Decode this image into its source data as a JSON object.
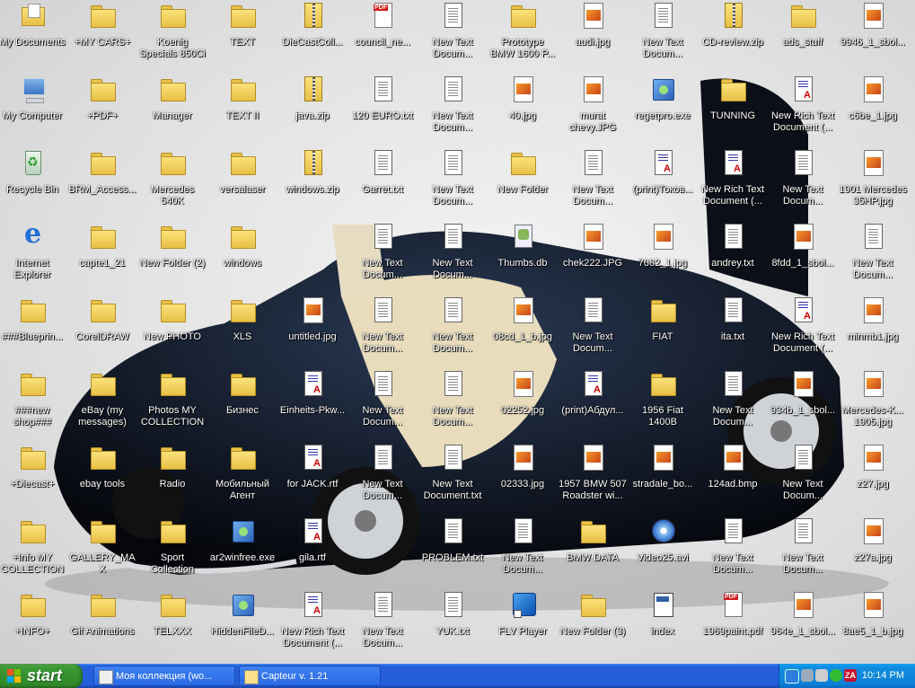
{
  "desktop": {
    "icons": [
      {
        "label": "My Documents",
        "type": "mydocs"
      },
      {
        "label": "My Computer",
        "type": "mycomp"
      },
      {
        "label": "Recycle Bin",
        "type": "recycle"
      },
      {
        "label": "Internet Explorer",
        "type": "ie"
      },
      {
        "label": "###Blueprin...",
        "type": "folder"
      },
      {
        "label": "###new shop###",
        "type": "folder"
      },
      {
        "label": "+Diecast+",
        "type": "folder"
      },
      {
        "label": "+Info MY COLLECTION+",
        "type": "folder"
      },
      {
        "label": "+INFO+",
        "type": "folder"
      },
      {
        "label": "+MY CARS+",
        "type": "folder"
      },
      {
        "label": "+PDF+",
        "type": "folder"
      },
      {
        "label": "BRM_Access...",
        "type": "folder"
      },
      {
        "label": "capte1_21",
        "type": "folder"
      },
      {
        "label": "CorelDRAW",
        "type": "folder"
      },
      {
        "label": "eBay (my messages)",
        "type": "folder"
      },
      {
        "label": "ebay tools",
        "type": "folder"
      },
      {
        "label": "GALLERY_MAX",
        "type": "folder"
      },
      {
        "label": "Gif Animations",
        "type": "folder"
      },
      {
        "label": "Koenig Specials 850Ci",
        "type": "folder"
      },
      {
        "label": "Manager",
        "type": "folder"
      },
      {
        "label": "Mercedes 540K",
        "type": "folder"
      },
      {
        "label": "New Folder (2)",
        "type": "folder"
      },
      {
        "label": "New PHOTO",
        "type": "folder"
      },
      {
        "label": "Photos MY COLLECTION",
        "type": "folder"
      },
      {
        "label": "Radio",
        "type": "folder"
      },
      {
        "label": "Sport Collection",
        "type": "folder"
      },
      {
        "label": "TELXXX",
        "type": "folder"
      },
      {
        "label": "TEXT",
        "type": "folder"
      },
      {
        "label": "TEXT II",
        "type": "folder"
      },
      {
        "label": "versalaser",
        "type": "folder"
      },
      {
        "label": "windows",
        "type": "folder"
      },
      {
        "label": "XLS",
        "type": "folder"
      },
      {
        "label": "Бизнес",
        "type": "folder"
      },
      {
        "label": "Мобильный Агент",
        "type": "folder"
      },
      {
        "label": "ar2winfree.exe",
        "type": "exe"
      },
      {
        "label": "HiddenFileD...",
        "type": "exe"
      },
      {
        "label": "DieCastColl...",
        "type": "zip"
      },
      {
        "label": "java.zip",
        "type": "zip"
      },
      {
        "label": "windows.zip",
        "type": "zip"
      },
      {
        "label": "",
        "type": "none"
      },
      {
        "label": "untitled.jpg",
        "type": "img"
      },
      {
        "label": "Einheits-Pkw...",
        "type": "rtf"
      },
      {
        "label": "for JACK.rtf",
        "type": "rtf"
      },
      {
        "label": "gila.rtf",
        "type": "rtf"
      },
      {
        "label": "New Rich Text Document (...",
        "type": "rtf"
      },
      {
        "label": "council_ne...",
        "type": "pdf"
      },
      {
        "label": "120 EURO.txt",
        "type": "doc"
      },
      {
        "label": "Garret.txt",
        "type": "doc"
      },
      {
        "label": "New Text Docum...",
        "type": "doc"
      },
      {
        "label": "New Text Docum...",
        "type": "doc"
      },
      {
        "label": "New Text Docum...",
        "type": "doc"
      },
      {
        "label": "New Text Docum...",
        "type": "doc"
      },
      {
        "label": "",
        "type": "none"
      },
      {
        "label": "New Text Docum...",
        "type": "doc"
      },
      {
        "label": "New Text Docum...",
        "type": "doc"
      },
      {
        "label": "New Text Docum...",
        "type": "doc"
      },
      {
        "label": "New Text Docum...",
        "type": "doc"
      },
      {
        "label": "New Text Docum...",
        "type": "doc"
      },
      {
        "label": "New Text Docum...",
        "type": "doc"
      },
      {
        "label": "New Text Docum...",
        "type": "doc"
      },
      {
        "label": "New Text Document.txt",
        "type": "doc"
      },
      {
        "label": "PROBLEM.txt",
        "type": "doc"
      },
      {
        "label": "YUK.txt",
        "type": "doc"
      },
      {
        "label": "Prototype BMW 1600 P...",
        "type": "folder"
      },
      {
        "label": "40.jpg",
        "type": "img"
      },
      {
        "label": "New Folder",
        "type": "folder"
      },
      {
        "label": "Thumbs.db",
        "type": "db"
      },
      {
        "label": "08cd_1_b.jpg",
        "type": "img"
      },
      {
        "label": "02252.jpg",
        "type": "img"
      },
      {
        "label": "02333.jpg",
        "type": "img"
      },
      {
        "label": "New Text Docum...",
        "type": "doc"
      },
      {
        "label": "FLV Player",
        "type": "flv"
      },
      {
        "label": "audi.jpg",
        "type": "img"
      },
      {
        "label": "murat chevy.JPG",
        "type": "img"
      },
      {
        "label": "New Text Docum...",
        "type": "doc"
      },
      {
        "label": "chek222.JPG",
        "type": "img"
      },
      {
        "label": "New Text Docum...",
        "type": "doc"
      },
      {
        "label": "(print)Абдул...",
        "type": "rtf"
      },
      {
        "label": "1957 BMW 507 Roadster wi...",
        "type": "img"
      },
      {
        "label": "BMW DATA",
        "type": "folder"
      },
      {
        "label": "New Folder (3)",
        "type": "folder"
      },
      {
        "label": "New Text Docum...",
        "type": "doc"
      },
      {
        "label": "regetpro.exe",
        "type": "exe"
      },
      {
        "label": "(print)Токов...",
        "type": "rtf"
      },
      {
        "label": "7082_1.jpg",
        "type": "img"
      },
      {
        "label": "FIAT",
        "type": "folder"
      },
      {
        "label": "1956 Fiat 1400B",
        "type": "folder"
      },
      {
        "label": "stradale_bo...",
        "type": "img"
      },
      {
        "label": "Video25.avi",
        "type": "avi"
      },
      {
        "label": "index",
        "type": "html"
      },
      {
        "label": "CD-review.zip",
        "type": "zip"
      },
      {
        "label": "TUNNING",
        "type": "folder"
      },
      {
        "label": "New Rich Text Document (...",
        "type": "rtf"
      },
      {
        "label": "andrey.txt",
        "type": "doc"
      },
      {
        "label": "ita.txt",
        "type": "doc"
      },
      {
        "label": "New Text Docum...",
        "type": "doc"
      },
      {
        "label": "124ad.bmp",
        "type": "img"
      },
      {
        "label": "New Text Docum...",
        "type": "doc"
      },
      {
        "label": "1969paint.pdf",
        "type": "pdf"
      },
      {
        "label": "ads_stuff",
        "type": "folder"
      },
      {
        "label": "New Rich Text Document (...",
        "type": "rtf"
      },
      {
        "label": "New Text Docum...",
        "type": "doc"
      },
      {
        "label": "8fdd_1_sbol...",
        "type": "img"
      },
      {
        "label": "New Rich Text Document (...",
        "type": "rtf"
      },
      {
        "label": "934b_1_sbol...",
        "type": "img"
      },
      {
        "label": "New Text Docum...",
        "type": "doc"
      },
      {
        "label": "New Text Docum...",
        "type": "doc"
      },
      {
        "label": "964e_1_sbol...",
        "type": "img"
      },
      {
        "label": "9946_1_sbol...",
        "type": "img"
      },
      {
        "label": "c6be_1.jpg",
        "type": "img"
      },
      {
        "label": "1901 Mercedes 35HP.jpg",
        "type": "img"
      },
      {
        "label": "New Text Docum...",
        "type": "doc"
      },
      {
        "label": "minmb1.jpg",
        "type": "img"
      },
      {
        "label": "Mercedes-K... 1905.jpg",
        "type": "img"
      },
      {
        "label": "z27.jpg",
        "type": "img"
      },
      {
        "label": "z27a.jpg",
        "type": "img"
      },
      {
        "label": "8ae5_1_b.jpg",
        "type": "img"
      }
    ]
  },
  "taskbar": {
    "start_label": "start",
    "tasks": [
      {
        "label": "Моя коллекция (wo...",
        "active": false
      },
      {
        "label": "Capteur v. 1.21",
        "active": false
      }
    ],
    "clock": "10:14 PM"
  }
}
